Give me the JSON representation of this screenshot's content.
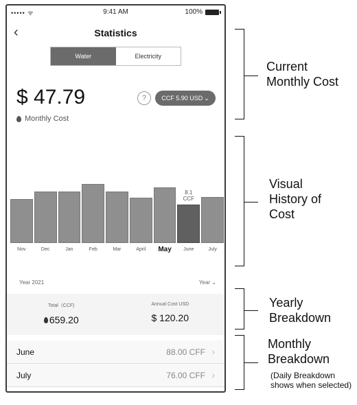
{
  "status_bar": {
    "signal": "•••••",
    "wifi": "ᯤ",
    "time": "9:41 AM",
    "battery": "100%"
  },
  "nav": {
    "title": "Statistics",
    "back_icon": "‹"
  },
  "tabs": [
    {
      "label": "Water",
      "active": true
    },
    {
      "label": "Electricity",
      "active": false
    }
  ],
  "summary": {
    "cost": "$ 47.79",
    "help_icon": "?",
    "rate_label": "CCF 5.90 USD",
    "rate_chevron": "⌄",
    "monthly_cost_label": "Monthly Cost"
  },
  "chart_data": {
    "type": "bar",
    "categories": [
      "Nov",
      "Dec",
      "Jan",
      "Feb",
      "Mar",
      "April",
      "May",
      "June",
      "July"
    ],
    "values": [
      7.5,
      8.7,
      8.7,
      10.0,
      8.7,
      7.7,
      9.4,
      6.5,
      7.8
    ],
    "selected_index": 7,
    "highlighted_tick_index": 6,
    "ylim": [
      0,
      14
    ],
    "selected_label_value": "8.1",
    "selected_label_unit": "CCF",
    "grid": false
  },
  "year_row": {
    "label": "Year 2021",
    "selector": "Year",
    "selector_chevron": "⌄"
  },
  "yearly": {
    "total_label": "Total（CCF)",
    "total_value": "659.20",
    "annual_label": "Annual Cost USD",
    "annual_value": "$ 120.20"
  },
  "months": [
    {
      "name": "June",
      "value": "88.00 CFF",
      "chevron": "›"
    },
    {
      "name": "July",
      "value": "76.00 CFF",
      "chevron": "›"
    }
  ],
  "annotations": {
    "current_monthly_cost": "Current Monthly Cost",
    "visual_history": "Visual History of Cost",
    "yearly_breakdown": "Yearly Breakdown",
    "monthly_breakdown": "Monthly Breakdown",
    "monthly_note": "(Daily Breakdown shows when selected)"
  }
}
